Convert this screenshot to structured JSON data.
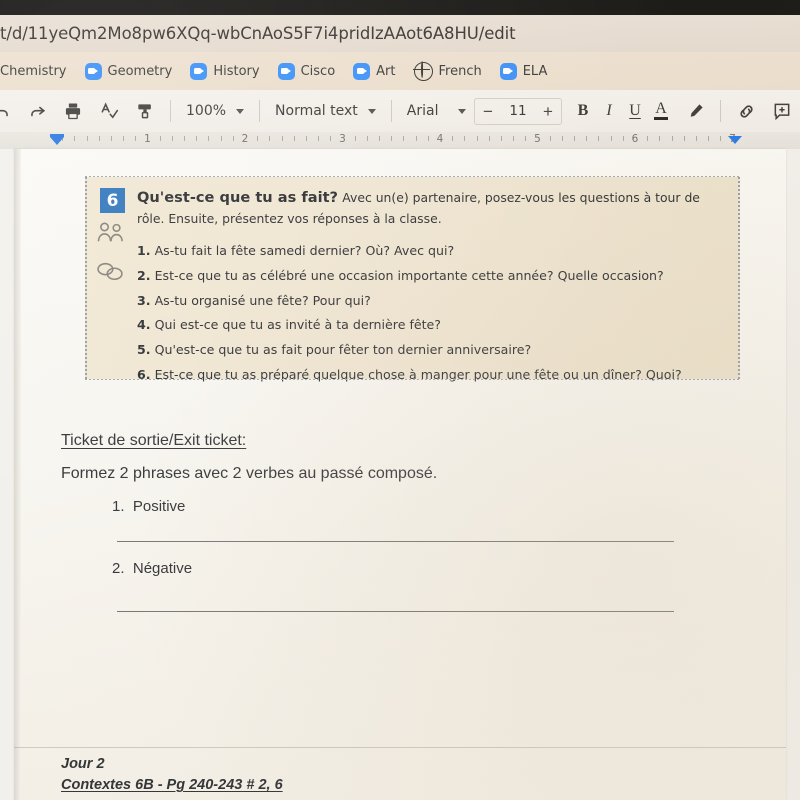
{
  "browser": {
    "url": "t/d/11yeQm2Mo8pw6XQq-wbCnAoS5F7i4pridIzAAot6A8HU/edit",
    "bookmarks": [
      {
        "label": "Chemistry",
        "icon": "none"
      },
      {
        "label": "Geometry",
        "icon": "zoom-icon"
      },
      {
        "label": "History",
        "icon": "zoom-icon"
      },
      {
        "label": "Cisco",
        "icon": "zoom-icon"
      },
      {
        "label": "Art",
        "icon": "zoom-icon"
      },
      {
        "label": "French",
        "icon": "globe-icon"
      },
      {
        "label": "ELA",
        "icon": "zoom-icon"
      }
    ]
  },
  "toolbar": {
    "zoom_level": "100%",
    "paragraph_style": "Normal text",
    "font_family": "Arial",
    "font_size": "11",
    "decrease_font_label": "−",
    "increase_font_label": "+",
    "bold_label": "B",
    "italic_label": "I",
    "underline_label": "U",
    "text_color_label": "A",
    "icons": [
      "undo-icon",
      "redo-icon",
      "print-icon",
      "spellcheck-icon",
      "paint-format-icon",
      "highlight-pen-icon",
      "link-icon",
      "add-comment-icon"
    ]
  },
  "ruler": {
    "numbers": [
      "1",
      "2",
      "3",
      "4",
      "5",
      "6",
      "7"
    ],
    "left_indent_inches": 0,
    "right_indent_inches": 6.6
  },
  "document": {
    "exercise": {
      "number": "6",
      "title": "Qu'est-ce que tu as fait?",
      "instructions_line1": "Avec un(e) partenaire, posez-vous les questions à tour de",
      "instructions_line2": "rôle. Ensuite, présentez vos réponses à la classe.",
      "icons": [
        "pair-work-icon",
        "speech-bubbles-icon"
      ],
      "questions": [
        {
          "n": "1.",
          "text": "As-tu fait la fête samedi dernier? Où? Avec qui?"
        },
        {
          "n": "2.",
          "text": "Est-ce que tu as célébré une occasion importante cette année? Quelle occasion?"
        },
        {
          "n": "3.",
          "text": "As-tu organisé une fête? Pour qui?"
        },
        {
          "n": "4.",
          "text": "Qui est-ce que tu as invité à ta dernière fête?"
        },
        {
          "n": "5.",
          "text": "Qu'est-ce que tu as fait pour fêter ton dernier anniversaire?"
        },
        {
          "n": "6.",
          "text": "Est-ce que tu as préparé quelque chose à manger pour une fête ou un dîner? Quoi?"
        }
      ]
    },
    "exit_ticket_heading": "Ticket de sortie/Exit ticket:",
    "exit_ticket_prompt": "Formez 2 phrases avec 2 verbes au passé composé.",
    "items": [
      {
        "label": "1.",
        "text": "Positive"
      },
      {
        "label": "2.",
        "text": "Négative"
      }
    ],
    "footer_line1": "Jour 2",
    "footer_line2": "Contextes 6B - Pg 240-243 # 2, 6"
  },
  "colors": {
    "exercise_number_blue": "#2170be",
    "bookmark_icon_blue": "#2d8cff",
    "ruler_indent_blue": "#1a73e8",
    "exercise_box_beige": "#efe4cf",
    "bookmarks_bar": "#ecddca",
    "url_bar": "#e4d9cc"
  }
}
